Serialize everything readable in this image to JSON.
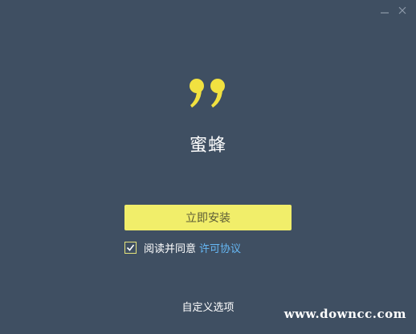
{
  "window": {
    "background": "#3f4f62",
    "controls": {
      "minimize_icon": "minimize-icon",
      "close_icon": "close-icon"
    }
  },
  "logo": {
    "icon": "quote-mark-icon",
    "color": "#f1e140"
  },
  "app": {
    "name": "蜜蜂"
  },
  "install": {
    "label": "立即安装",
    "color": "#f1ee6a"
  },
  "agreement": {
    "checked": true,
    "text": "阅读并同意",
    "link_label": "许可协议",
    "link_color": "#66b8f5"
  },
  "custom_options": {
    "label": "自定义选项"
  },
  "watermark": {
    "text": "www.downcc.com"
  }
}
